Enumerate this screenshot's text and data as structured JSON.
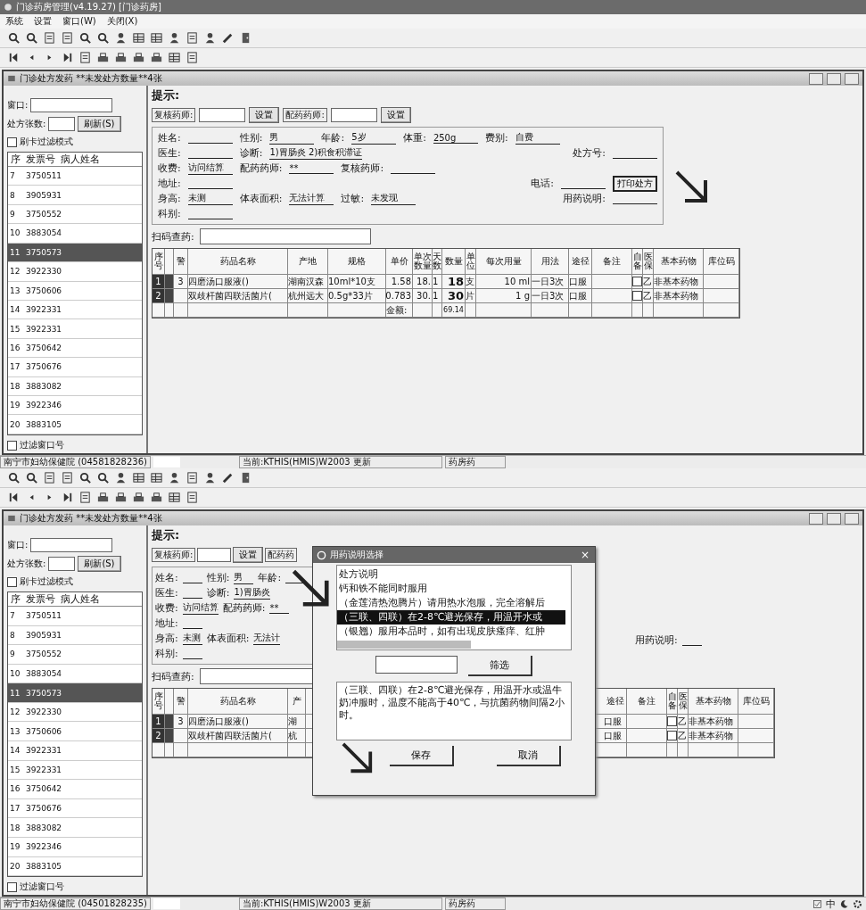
{
  "window": {
    "title": "门诊药房管理(v4.19.27) [门诊药房]"
  },
  "menu": [
    {
      "label": "系统"
    },
    {
      "label": "设置"
    },
    {
      "label": "窗口(W)"
    },
    {
      "label": "关闭(X)"
    }
  ],
  "screens": [
    {
      "child_title": "门诊处方发药  **未发处方数量**4张",
      "sidebar": {
        "code_label": "窗口:",
        "count_label": "处方张数:",
        "refresh_button": "刷新(S)",
        "filter_mode": {
          "label": "刷卡过滤模式",
          "checked": false
        },
        "columns": [
          "序",
          "发票号",
          "病人姓名"
        ],
        "rows": [
          {
            "no": "7",
            "invoice": "3750511",
            "selected": false
          },
          {
            "no": "8",
            "invoice": "3905931",
            "selected": false
          },
          {
            "no": "9",
            "invoice": "3750552",
            "selected": false
          },
          {
            "no": "10",
            "invoice": "3883054",
            "selected": false
          },
          {
            "no": "11",
            "invoice": "3750573",
            "selected": true
          },
          {
            "no": "12",
            "invoice": "3922330",
            "selected": false
          },
          {
            "no": "13",
            "invoice": "3750606",
            "selected": false
          },
          {
            "no": "14",
            "invoice": "3922331",
            "selected": false
          },
          {
            "no": "15",
            "invoice": "3922331",
            "selected": false
          },
          {
            "no": "16",
            "invoice": "3750642",
            "selected": false
          },
          {
            "no": "17",
            "invoice": "3750676",
            "selected": false
          },
          {
            "no": "18",
            "invoice": "3883082",
            "selected": false
          },
          {
            "no": "19",
            "invoice": "3922346",
            "selected": false
          },
          {
            "no": "20",
            "invoice": "3883105",
            "selected": false
          }
        ],
        "window_filter": {
          "label": "过滤窗口号",
          "checked": false
        }
      },
      "hint": "提示:",
      "pharmacists": [
        {
          "label": "复核药师:",
          "button": "设置"
        },
        {
          "label": "配药药师:",
          "button": "设置"
        }
      ],
      "form": [
        {
          "items": [
            {
              "kind": "field",
              "label": "姓名:"
            },
            {
              "kind": "field",
              "label": "性别:",
              "value": "男"
            },
            {
              "kind": "field",
              "label": "年龄:",
              "value": "5岁"
            },
            {
              "kind": "field",
              "label": "体重:",
              "value": "250g"
            },
            {
              "kind": "field",
              "label": "费别:",
              "value": "自费"
            }
          ]
        },
        {
          "items": [
            {
              "kind": "field",
              "label": "医生:"
            },
            {
              "kind": "field",
              "label": "诊断:",
              "value": "1)胃肠炎 2)积食积滞证"
            }
          ],
          "right": [
            {
              "kind": "field",
              "label": "处方号:"
            }
          ]
        },
        {
          "items": [
            {
              "kind": "field",
              "label": "收费:",
              "value": "访问结算"
            },
            {
              "kind": "field",
              "label": "配药药师:",
              "value": "**"
            },
            {
              "kind": "field",
              "label": "复核药师:"
            }
          ]
        },
        {
          "items": [
            {
              "kind": "field",
              "label": "地址:"
            }
          ],
          "right": [
            {
              "kind": "field",
              "label": "电话:"
            },
            {
              "kind": "button",
              "label": "打印处方"
            }
          ]
        },
        {
          "items": [
            {
              "kind": "field",
              "label": "身高:",
              "value": "未测"
            },
            {
              "kind": "field",
              "label": "体表面积:",
              "value": "无法计算"
            },
            {
              "kind": "field",
              "label": "过敏:",
              "value": "未发现"
            }
          ],
          "right": [
            {
              "kind": "field",
              "label": "用药说明:"
            }
          ]
        },
        {
          "items": [
            {
              "kind": "field",
              "label": "科别:"
            }
          ]
        }
      ],
      "scan_label": "扫码查药:",
      "table": {
        "columns": [
          {
            "label": "序号"
          },
          {
            "kind": "marker"
          },
          {
            "label": "警"
          },
          {
            "label": "药品名称"
          },
          {
            "label": "产地"
          },
          {
            "label": "规格"
          },
          {
            "label": "单价"
          },
          {
            "label": "单次数量"
          },
          {
            "label": "天数"
          },
          {
            "label": "数量"
          },
          {
            "label": "单位"
          },
          {
            "label": "每次用量"
          },
          {
            "label": "用法"
          },
          {
            "label": "途径"
          },
          {
            "label": "备注"
          },
          {
            "label": "自备",
            "kind": "checkbox"
          },
          {
            "label": "医保"
          },
          {
            "label": "基本药物"
          },
          {
            "label": "库位码"
          }
        ],
        "rows": [
          {
            "cells": [
              "1",
              null,
              "3",
              "四磨汤口服液()",
              "湖南汉森",
              "10ml*10支",
              "1.58",
              "18.",
              "1",
              "18",
              "支",
              "10 ml",
              "一日3次",
              "口服",
              null,
              {
                "checked": false
              },
              "乙",
              "非基本药物",
              null
            ]
          },
          {
            "cells": [
              "2",
              null,
              null,
              "双歧杆菌四联活菌片(",
              "杭州远大",
              "0.5g*33片",
              "0.783",
              "30.",
              "1",
              "30",
              "片",
              "1 g",
              "一日3次",
              "口服",
              null,
              {
                "checked": false
              },
              "乙",
              "非基本药物",
              null
            ]
          }
        ],
        "total": {
          "label": "金额:",
          "value": "69.14"
        }
      },
      "status_bar": [
        "南宁市妇幼保健院 (04581828236)",
        "当前:KTHIS(HMIS)W2003 更新",
        "药房药"
      ]
    },
    {
      "sidebar": {
        "code_label": "窗口:",
        "count_label": "处方张数:",
        "refresh_button": "刷新(S)",
        "filter_mode": {
          "label": "刷卡过滤模式",
          "checked": false
        },
        "columns": [
          "序",
          "发票号",
          "病人姓名"
        ],
        "rows": [
          {
            "no": "7",
            "invoice": "3750511",
            "selected": false
          },
          {
            "no": "8",
            "invoice": "3905931",
            "selected": false
          },
          {
            "no": "9",
            "invoice": "3750552",
            "selected": false
          },
          {
            "no": "10",
            "invoice": "3883054",
            "selected": false
          },
          {
            "no": "11",
            "invoice": "3750573",
            "selected": true
          },
          {
            "no": "12",
            "invoice": "3922330",
            "selected": false
          },
          {
            "no": "13",
            "invoice": "3750606",
            "selected": false
          },
          {
            "no": "14",
            "invoice": "3922331",
            "selected": false
          },
          {
            "no": "15",
            "invoice": "3922331",
            "selected": false
          },
          {
            "no": "16",
            "invoice": "3750642",
            "selected": false
          },
          {
            "no": "17",
            "invoice": "3750676",
            "selected": false
          },
          {
            "no": "18",
            "invoice": "3883082",
            "selected": false
          },
          {
            "no": "19",
            "invoice": "3922346",
            "selected": false
          },
          {
            "no": "20",
            "invoice": "3883105",
            "selected": false
          }
        ],
        "window_filter": {
          "label": "过滤窗口号",
          "checked": false
        }
      },
      "child_title": "门诊处方发药  **未发处方数量**4张",
      "hint": "提示:",
      "pharmacists": [
        {
          "label": "复核药师:",
          "button": "设置"
        },
        {
          "label": "配药药"
        }
      ],
      "form": [
        {
          "items": [
            {
              "kind": "field",
              "label": "姓名:"
            },
            {
              "kind": "field",
              "label": "性别:",
              "value": "男"
            },
            {
              "kind": "field",
              "label": "年龄:"
            }
          ]
        },
        {
          "items": [
            {
              "kind": "field",
              "label": "医生:"
            },
            {
              "kind": "field",
              "label": "诊断:",
              "value": "1)胃肠炎"
            }
          ]
        },
        {
          "items": [
            {
              "kind": "field",
              "label": "收费:",
              "value": "访问结算"
            },
            {
              "kind": "field",
              "label": "配药药师:",
              "value": "**"
            }
          ]
        },
        {
          "items": [
            {
              "kind": "field",
              "label": "地址:"
            }
          ]
        },
        {
          "items": [
            {
              "kind": "field",
              "label": "身高:",
              "value": "未测"
            },
            {
              "kind": "field",
              "label": "体表面积:",
              "value": "无法计"
            }
          ],
          "right": [
            {
              "kind": "field",
              "label": "用药说明:"
            }
          ]
        },
        {
          "items": [
            {
              "kind": "field",
              "label": "科别:"
            }
          ]
        }
      ],
      "scan_label": "扫码查药:",
      "table": {
        "columns": [
          {
            "label": "序号"
          },
          {
            "kind": "marker"
          },
          {
            "label": "警"
          },
          {
            "label": "药品名称"
          },
          {
            "label": "产"
          },
          {
            "label": "途径"
          },
          {
            "label": "备注"
          },
          {
            "label": "自备",
            "kind": "checkbox"
          },
          {
            "label": "医保"
          },
          {
            "label": "基本药物"
          },
          {
            "label": "库位码"
          }
        ],
        "rows": [
          {
            "cells": [
              "1",
              null,
              "3",
              "四磨汤口服液()",
              "湖",
              "口服",
              null,
              {
                "checked": false
              },
              "乙",
              "非基本药物",
              null
            ]
          },
          {
            "cells": [
              "2",
              null,
              null,
              "双歧杆菌四联活菌片(",
              "杭",
              "口服",
              null,
              {
                "checked": false
              },
              "乙",
              "非基本药物",
              null
            ]
          }
        ]
      },
      "dialog": {
        "title": "用药说明选择",
        "close": "×",
        "items": [
          {
            "text": "处方说明",
            "selected": false
          },
          {
            "text": "钙和铁不能同时服用",
            "selected": false
          },
          {
            "text": "（金莲清热泡腾片）请用热水泡服，完全溶解后",
            "selected": false
          },
          {
            "text": "（三联、四联）在2-8℃避光保存，用温开水或",
            "selected": true
          },
          {
            "text": "（银翘）服用本品时，如有出现皮肤瘙痒、红肿",
            "selected": false
          }
        ],
        "filter_button": "筛选",
        "text": "（三联、四联）在2-8℃避光保存，用温开水或温牛奶冲服时，温度不能高于40℃，与抗菌药物间隔2小时。",
        "buttons": [
          "保存",
          "取消"
        ]
      },
      "status_bar": [
        "南宁市妇幼保健院 (04501828235)",
        "当前:KTHIS(HMIS)W2003 更新",
        "药房药"
      ],
      "tray_text": "中"
    }
  ]
}
